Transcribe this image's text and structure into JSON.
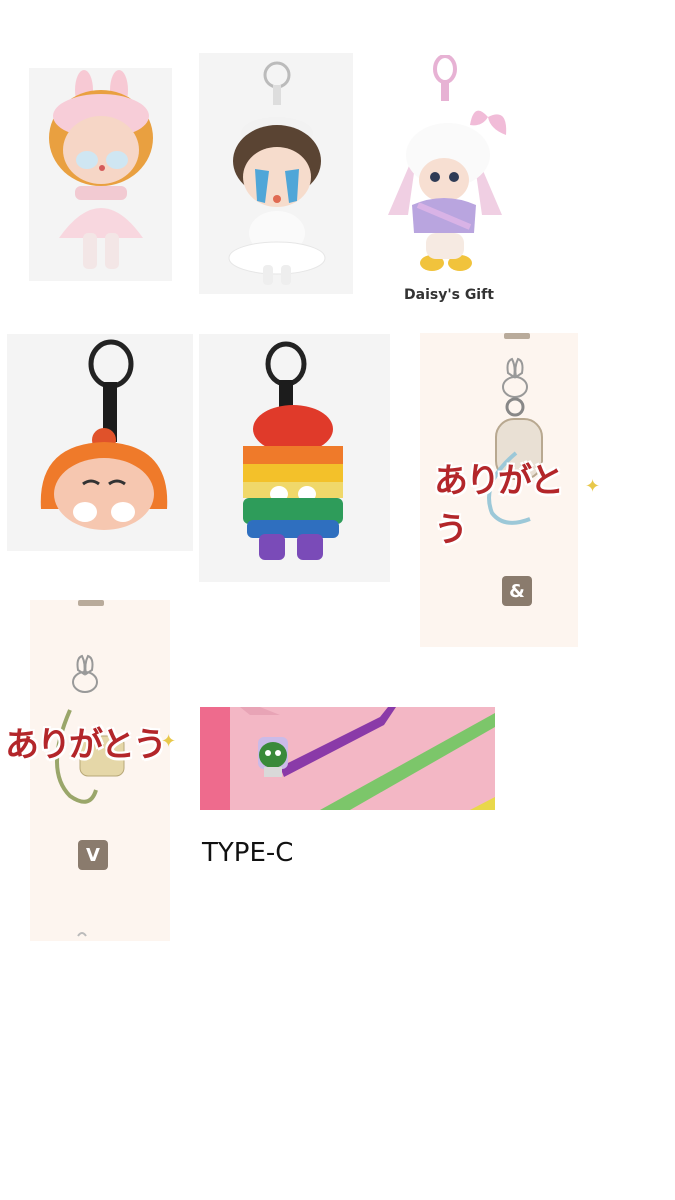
{
  "items": [
    {
      "id": "crybaby-bunny-ballerina",
      "icon": "plush-doll-pink-bunny-ears"
    },
    {
      "id": "crybaby-white-ballerina",
      "icon": "plush-doll-white-tutu"
    },
    {
      "id": "daisy-gift",
      "caption": "Daisy's Gift",
      "icon": "plush-doll-daisy-duck"
    },
    {
      "id": "orange-head-keychain",
      "icon": "plush-head-keychain-orange"
    },
    {
      "id": "rainbow-keychain",
      "icon": "plush-doll-keychain-rainbow"
    },
    {
      "id": "charm-ampersand",
      "thanks": "ありがとう",
      "letter": "&",
      "icon": "bunny-charm-strap"
    },
    {
      "id": "charm-v",
      "thanks": "ありがとう",
      "letter": "V",
      "icon": "bunny-charm-strap"
    },
    {
      "id": "type-c-cable",
      "caption": "TYPE-C",
      "icon": "type-c-cable-character"
    }
  ],
  "colors": {
    "tile_gray": "#f4f4f4",
    "tile_cream": "#fdf5ef",
    "thanks_red": "#b3262a",
    "cable_pink": "#f2b8c6"
  }
}
